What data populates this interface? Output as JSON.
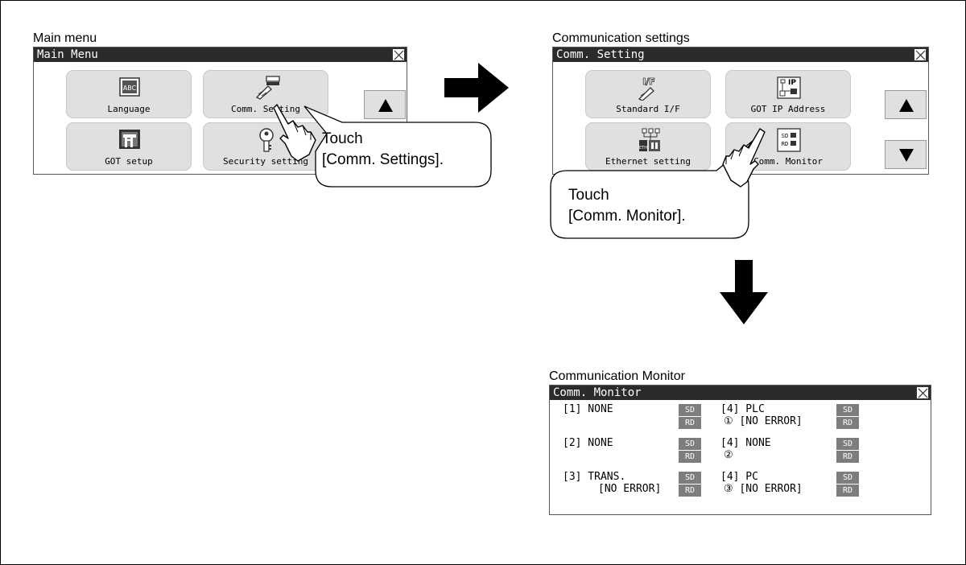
{
  "main_menu_panel": {
    "caption": "Main menu",
    "title": "Main Menu",
    "tiles": [
      {
        "label": "Language",
        "icon": "language-icon"
      },
      {
        "label": "Comm. Setting",
        "icon": "comm-setting-icon"
      },
      {
        "label": "GOT setup",
        "icon": "got-setup-icon"
      },
      {
        "label": "Security setting",
        "icon": "security-key-icon"
      }
    ],
    "up_button": "up-arrow-icon",
    "callout": [
      "Touch",
      "[Comm. Settings]."
    ]
  },
  "comm_setting_panel": {
    "caption": "Communication settings",
    "title": "Comm. Setting",
    "tiles": [
      {
        "label": "Standard I/F",
        "icon": "interface-icon"
      },
      {
        "label": "GOT IP Address",
        "icon": "ip-address-icon"
      },
      {
        "label": "Ethernet setting",
        "icon": "ethernet-icon"
      },
      {
        "label": "Comm. Monitor",
        "icon": "sd-rd-monitor-icon"
      }
    ],
    "callout": [
      "Touch",
      "[Comm. Monitor]."
    ]
  },
  "comm_monitor_panel": {
    "caption": "Communication Monitor",
    "title": "Comm. Monitor",
    "sd_label": "SD",
    "rd_label": "RD",
    "left_channels": [
      {
        "line1": "[1] NONE",
        "line2": ""
      },
      {
        "line1": "[2] NONE",
        "line2": ""
      },
      {
        "line1": "[3] TRANS.",
        "line2": "[NO ERROR]"
      }
    ],
    "right_channels": [
      {
        "line1": "[4] PLC",
        "line2": "① [NO ERROR]"
      },
      {
        "line1": "[4] NONE",
        "line2": "②"
      },
      {
        "line1": "[4] PC",
        "line2": "③ [NO ERROR]"
      }
    ]
  },
  "colors": {
    "titlebar": "#2b2b2b",
    "tile": "#e0e0e0",
    "lamp": "#7d7d7d"
  }
}
